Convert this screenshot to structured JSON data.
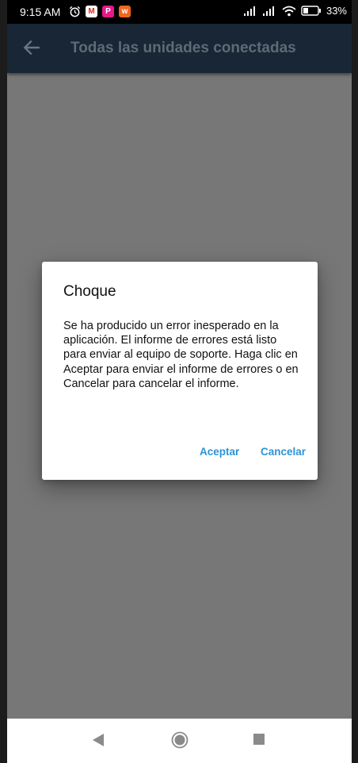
{
  "status_bar": {
    "time": "9:15 AM",
    "battery_percent": "33%",
    "icons": [
      "alarm-icon",
      "gmail-icon",
      "app-p-icon",
      "app-w-icon",
      "signal-icon",
      "signal-icon",
      "wifi-icon",
      "battery-icon"
    ]
  },
  "app_bar": {
    "title": "Todas las unidades conectadas",
    "back_icon": "arrow-left-icon"
  },
  "dialog": {
    "title": "Choque",
    "message": "Se ha producido un error inesperado en la aplicación. El informe de errores está listo para enviar al equipo de soporte. Haga clic en Aceptar para enviar el informe de errores o en Cancelar para cancelar el informe.",
    "accept_label": "Aceptar",
    "cancel_label": "Cancelar"
  },
  "colors": {
    "app_bar": "#182635",
    "overlay": "#777777",
    "accent": "#2e93d6"
  }
}
